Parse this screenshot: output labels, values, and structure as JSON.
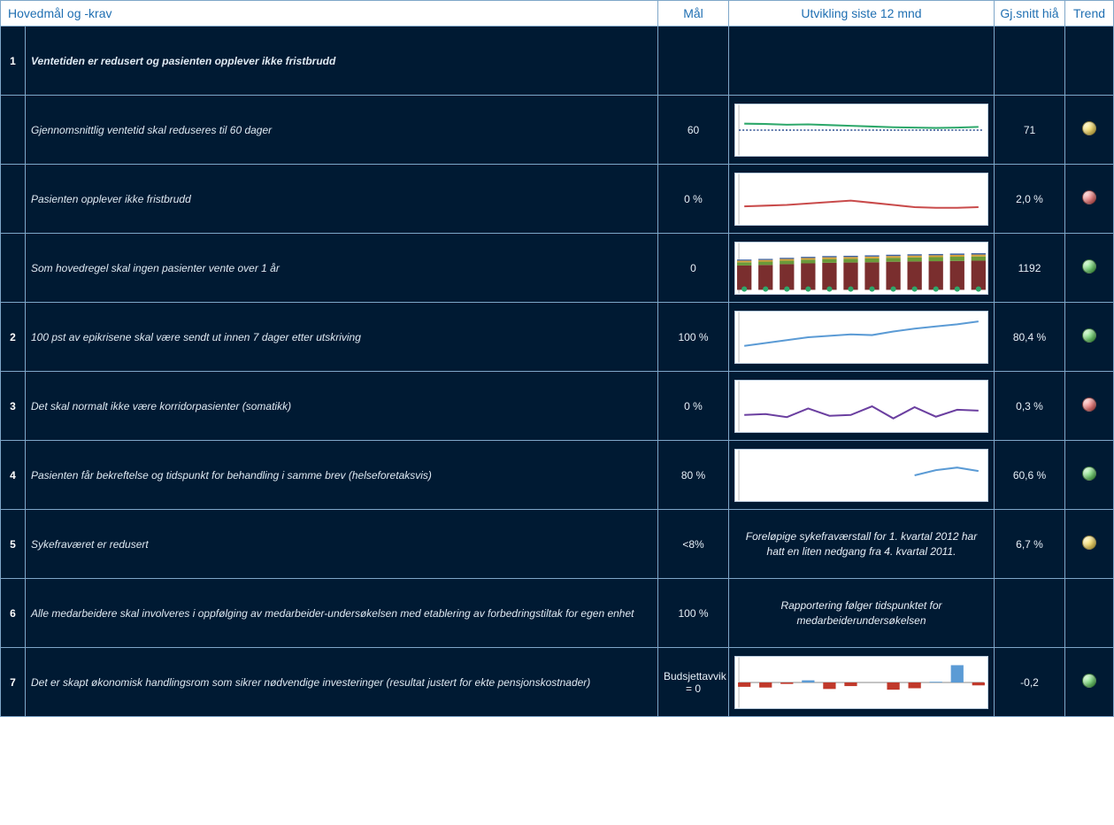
{
  "headers": {
    "h1": "Hovedmål og -krav",
    "h2": "Mål",
    "h3": "Utvikling siste 12 mnd",
    "h4": "Gj.snitt hiå",
    "h5": "Trend"
  },
  "rows": [
    {
      "num": "1",
      "desc": "Ventetiden er redusert og pasienten opplever ikke fristbrudd",
      "goal": "",
      "chart": null,
      "avg": "",
      "trend": ""
    },
    {
      "num": "",
      "desc": "Gjennomsnittlig ventetid skal reduseres til 60 dager",
      "goal": "60",
      "chart": "c1",
      "avg": "71",
      "trend": "yellow"
    },
    {
      "num": "",
      "desc": "Pasienten opplever ikke fristbrudd",
      "goal": "0 %",
      "chart": "c2",
      "avg": "2,0 %",
      "trend": "red"
    },
    {
      "num": "",
      "desc": "Som hovedregel skal ingen pasienter vente over 1 år",
      "goal": "0",
      "chart": "c3",
      "avg": "1192",
      "trend": "green"
    },
    {
      "num": "2",
      "desc": "100 pst av epikrisene skal være sendt ut innen 7 dager etter utskriving",
      "goal": "100 %",
      "chart": "c4",
      "avg": "80,4 %",
      "trend": "green"
    },
    {
      "num": "3",
      "desc": "Det skal normalt ikke være korridorpasienter (somatikk)",
      "goal": "0 %",
      "chart": "c5",
      "avg": "0,3 %",
      "trend": "red"
    },
    {
      "num": "4",
      "desc": "Pasienten får bekreftelse og tidspunkt for behandling i samme brev (helseforetaksvis)",
      "goal": "80 %",
      "chart": "c6",
      "avg": "60,6 %",
      "trend": "green"
    },
    {
      "num": "5",
      "desc": "Sykefraværet er redusert",
      "goal": "<8%",
      "chart": "note1",
      "avg": "6,7 %",
      "trend": "yellow"
    },
    {
      "num": "6",
      "desc": "Alle medarbeidere skal involveres i oppfølging av medarbeider-undersøkelsen med etablering av forbedringstiltak for egen enhet",
      "goal": "100 %",
      "chart": "note2",
      "avg": "",
      "trend": ""
    },
    {
      "num": "7",
      "desc": "Det er skapt økonomisk handlingsrom som sikrer nødvendige investeringer (resultat justert for ekte pensjonskostnader)",
      "goal": "Budsjettavvik = 0",
      "chart": "c7",
      "avg": "-0,2",
      "trend": "green"
    }
  ],
  "notes": {
    "note1": "Foreløpige sykefraværstall for 1. kvartal 2012 har hatt en liten nedgang fra 4. kvartal 2011.",
    "note2": "Rapportering følger tidspunktet for medarbeiderundersøkelsen"
  },
  "chart_data": [
    {
      "id": "c1",
      "type": "line",
      "color": "#2ea86b",
      "baseline": 60,
      "ylim": [
        0,
        120
      ],
      "x": [
        1,
        2,
        3,
        4,
        5,
        6,
        7,
        8,
        9,
        10,
        11,
        12
      ],
      "values": [
        78,
        77,
        75,
        76,
        74,
        72,
        70,
        68,
        67,
        66,
        67,
        69
      ]
    },
    {
      "id": "c2",
      "type": "line",
      "color": "#c94b4b",
      "ylim": [
        0,
        6
      ],
      "x": [
        1,
        2,
        3,
        4,
        5,
        6,
        7,
        8,
        9,
        10,
        11,
        12
      ],
      "values": [
        2.0,
        2.1,
        2.2,
        2.4,
        2.6,
        2.8,
        2.5,
        2.2,
        1.9,
        1.8,
        1.8,
        1.9
      ]
    },
    {
      "id": "c3",
      "type": "stacked_bar",
      "ylim": [
        0,
        1600
      ],
      "categories": [
        1,
        2,
        3,
        4,
        5,
        6,
        7,
        8,
        9,
        10,
        11,
        12
      ],
      "series": [
        {
          "name": "a",
          "color": "#7a2e2e",
          "values": [
            900,
            920,
            950,
            980,
            1000,
            1010,
            1020,
            1040,
            1050,
            1060,
            1070,
            1080
          ]
        },
        {
          "name": "b",
          "color": "#6a9a3a",
          "values": [
            120,
            125,
            130,
            135,
            140,
            140,
            145,
            145,
            150,
            150,
            155,
            155
          ]
        },
        {
          "name": "c",
          "color": "#d6a23a",
          "values": [
            60,
            60,
            62,
            63,
            65,
            65,
            66,
            67,
            68,
            68,
            69,
            70
          ]
        },
        {
          "name": "d",
          "color": "#3a5fa0",
          "values": [
            40,
            40,
            42,
            43,
            45,
            45,
            46,
            47,
            48,
            48,
            49,
            50
          ]
        }
      ],
      "markers": {
        "color": "#2ea86b",
        "values": [
          30,
          30,
          30,
          30,
          30,
          30,
          30,
          30,
          30,
          30,
          30,
          30
        ]
      }
    },
    {
      "id": "c4",
      "type": "line",
      "color": "#5b9bd5",
      "ylim": [
        40,
        100
      ],
      "x": [
        1,
        2,
        3,
        4,
        5,
        6,
        7,
        8,
        9,
        10,
        11,
        12
      ],
      "values": [
        58,
        62,
        66,
        70,
        72,
        74,
        73,
        78,
        82,
        85,
        88,
        92
      ]
    },
    {
      "id": "c5",
      "type": "line",
      "color": "#6b3fa0",
      "ylim": [
        0,
        1
      ],
      "x": [
        1,
        2,
        3,
        4,
        5,
        6,
        7,
        8,
        9,
        10,
        11,
        12
      ],
      "values": [
        0.3,
        0.32,
        0.25,
        0.45,
        0.28,
        0.3,
        0.5,
        0.22,
        0.48,
        0.26,
        0.42,
        0.4
      ]
    },
    {
      "id": "c6",
      "type": "line",
      "color": "#5b9bd5",
      "ylim": [
        0,
        100
      ],
      "x": [
        1,
        2,
        3,
        4,
        5,
        6,
        7,
        8,
        9,
        10,
        11,
        12
      ],
      "values": [
        null,
        null,
        null,
        null,
        null,
        null,
        null,
        null,
        50,
        62,
        68,
        60
      ]
    },
    {
      "id": "c7",
      "type": "bar",
      "color_pos": "#5b9bd5",
      "color_neg": "#c0392b",
      "ylim": [
        -1.5,
        1.5
      ],
      "categories": [
        1,
        2,
        3,
        4,
        5,
        6,
        7,
        8,
        9,
        10,
        11,
        12
      ],
      "values": [
        -0.3,
        -0.35,
        -0.1,
        0.15,
        -0.45,
        -0.25,
        0.0,
        -0.5,
        -0.4,
        0.05,
        1.2,
        -0.2
      ]
    }
  ]
}
